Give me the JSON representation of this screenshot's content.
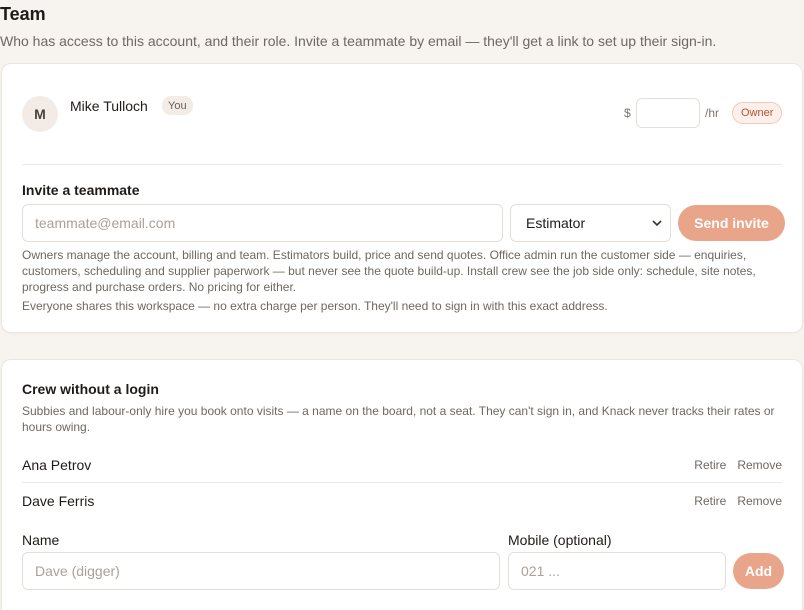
{
  "header": {
    "title": "Team",
    "subtitle": "Who has access to this account, and their role. Invite a teammate by email — they'll get a link to set up their sign-in."
  },
  "member": {
    "initial": "M",
    "name": "Mike Tulloch",
    "you_badge": "You",
    "currency": "$",
    "rate_value": "",
    "rate_unit": "/hr",
    "role_badge": "Owner"
  },
  "invite": {
    "title": "Invite a teammate",
    "email_placeholder": "teammate@email.com",
    "role_selected": "Estimator",
    "send_label": "Send invite",
    "help_roles": "Owners manage the account, billing and team. Estimators build, price and send quotes. Office admin run the customer side — enquiries, customers, scheduling and supplier paperwork — but never see the quote build-up. Install crew see the job side only: schedule, site notes, progress and purchase orders. No pricing for either.",
    "help_workspace": "Everyone shares this workspace — no extra charge per person. They'll need to sign in with this exact address."
  },
  "crew": {
    "title": "Crew without a login",
    "description": "Subbies and labour-only hire you book onto visits — a name on the board, not a seat. They can't sign in, and Knack never tracks their rates or hours owing.",
    "members": [
      {
        "name": "Ana Petrov",
        "retire_label": "Retire",
        "remove_label": "Remove"
      },
      {
        "name": "Dave Ferris",
        "retire_label": "Retire",
        "remove_label": "Remove"
      }
    ],
    "name_label": "Name",
    "name_placeholder": "Dave (digger)",
    "mobile_label": "Mobile (optional)",
    "mobile_placeholder": "021 ...",
    "add_label": "Add"
  },
  "colors": {
    "accent": "#e9a58a",
    "owner_badge_text": "#b05532",
    "background": "#f7f3ef"
  }
}
